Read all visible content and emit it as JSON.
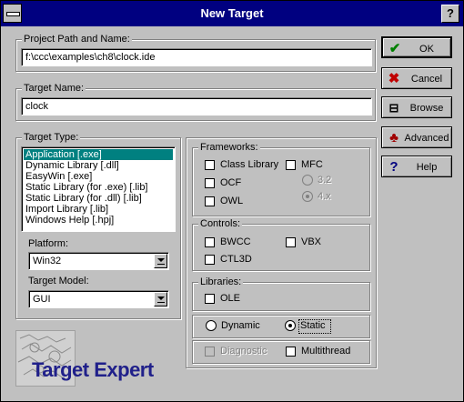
{
  "window": {
    "title": "New Target",
    "help_glyph": "?"
  },
  "project_path": {
    "label": "Project Path and Name:",
    "value": "f:\\ccc\\examples\\ch8\\clock.ide"
  },
  "target_name": {
    "label": "Target Name:",
    "value": "clock"
  },
  "buttons": {
    "ok": {
      "label": "OK",
      "icon": "check-icon"
    },
    "cancel": {
      "label": "Cancel",
      "icon": "x-icon"
    },
    "browse": {
      "label": "Browse",
      "icon": "browse-icon"
    },
    "advanced": {
      "label": "Advanced",
      "icon": "advanced-icon"
    },
    "help": {
      "label": "Help",
      "icon": "question-icon"
    }
  },
  "target_type": {
    "label": "Target Type:",
    "items": [
      "Application [.exe]",
      "Dynamic Library [.dll]",
      "EasyWin [.exe]",
      "Static Library (for .exe) [.lib]",
      "Static Library (for .dll) [.lib]",
      "Import Library [.lib]",
      "Windows Help [.hpj]"
    ],
    "selected_index": 0
  },
  "platform": {
    "label": "Platform:",
    "value": "Win32"
  },
  "target_model": {
    "label": "Target Model:",
    "value": "GUI"
  },
  "frameworks": {
    "label": "Frameworks:",
    "class_library": "Class Library",
    "mfc": "MFC",
    "mfc_v32": "3.2",
    "mfc_v4x": "4.x",
    "ocf": "OCF",
    "owl": "OWL"
  },
  "controls": {
    "label": "Controls:",
    "bwcc": "BWCC",
    "vbx": "VBX",
    "ctl3d": "CTL3D"
  },
  "libraries": {
    "label": "Libraries:",
    "ole": "OLE"
  },
  "linking": {
    "dynamic": "Dynamic",
    "static": "Static",
    "selected": "Static"
  },
  "options": {
    "diagnostic": "Diagnostic",
    "multithread": "Multithread"
  },
  "logo": {
    "text": "Target Expert"
  },
  "colors": {
    "titlebar": "#000080",
    "selection": "#008080",
    "face": "#c0c0c0",
    "logo_text": "#20208a"
  }
}
